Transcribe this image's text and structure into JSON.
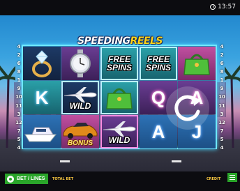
{
  "status_bar": {
    "time": "13:57"
  },
  "game": {
    "logo_part1": "SPEEDING",
    "logo_part2": "REELS",
    "paylines_left": [
      "4",
      "2",
      "6",
      "8",
      "1",
      "9",
      "10",
      "11",
      "3",
      "12",
      "7",
      "5",
      "4"
    ],
    "paylines_right": [
      "4",
      "2",
      "6",
      "8",
      "1",
      "9",
      "10",
      "11",
      "3",
      "12",
      "7",
      "5",
      "4"
    ],
    "reels": [
      [
        {
          "symbol": "diamond-ring"
        },
        {
          "symbol": "K"
        },
        {
          "symbol": "yacht"
        }
      ],
      [
        {
          "symbol": "watch"
        },
        {
          "symbol": "jet-wild",
          "label": "WILD"
        },
        {
          "symbol": "sports-car",
          "label": "BONUS"
        }
      ],
      [
        {
          "symbol": "free-spins",
          "label1": "FREE",
          "label2": "SPINS"
        },
        {
          "symbol": "green-handbag"
        },
        {
          "symbol": "jet-wild",
          "label": "WILD"
        }
      ],
      [
        {
          "symbol": "free-spins",
          "label1": "FREE",
          "label2": "SPINS"
        },
        {
          "symbol": "Q"
        },
        {
          "symbol": "A"
        }
      ],
      [
        {
          "symbol": "green-handbag"
        },
        {
          "symbol": "A"
        },
        {
          "symbol": "J"
        }
      ]
    ]
  },
  "bottom_bar": {
    "bet_lines_label": "BET / LINES",
    "total_bet_label": "TOTAL BET",
    "credit_label": "CREDIT"
  },
  "colors": {
    "accent_green": "#2aa52a",
    "label_gold": "#f7c640",
    "frame_cyan": "#6fe8ff"
  }
}
